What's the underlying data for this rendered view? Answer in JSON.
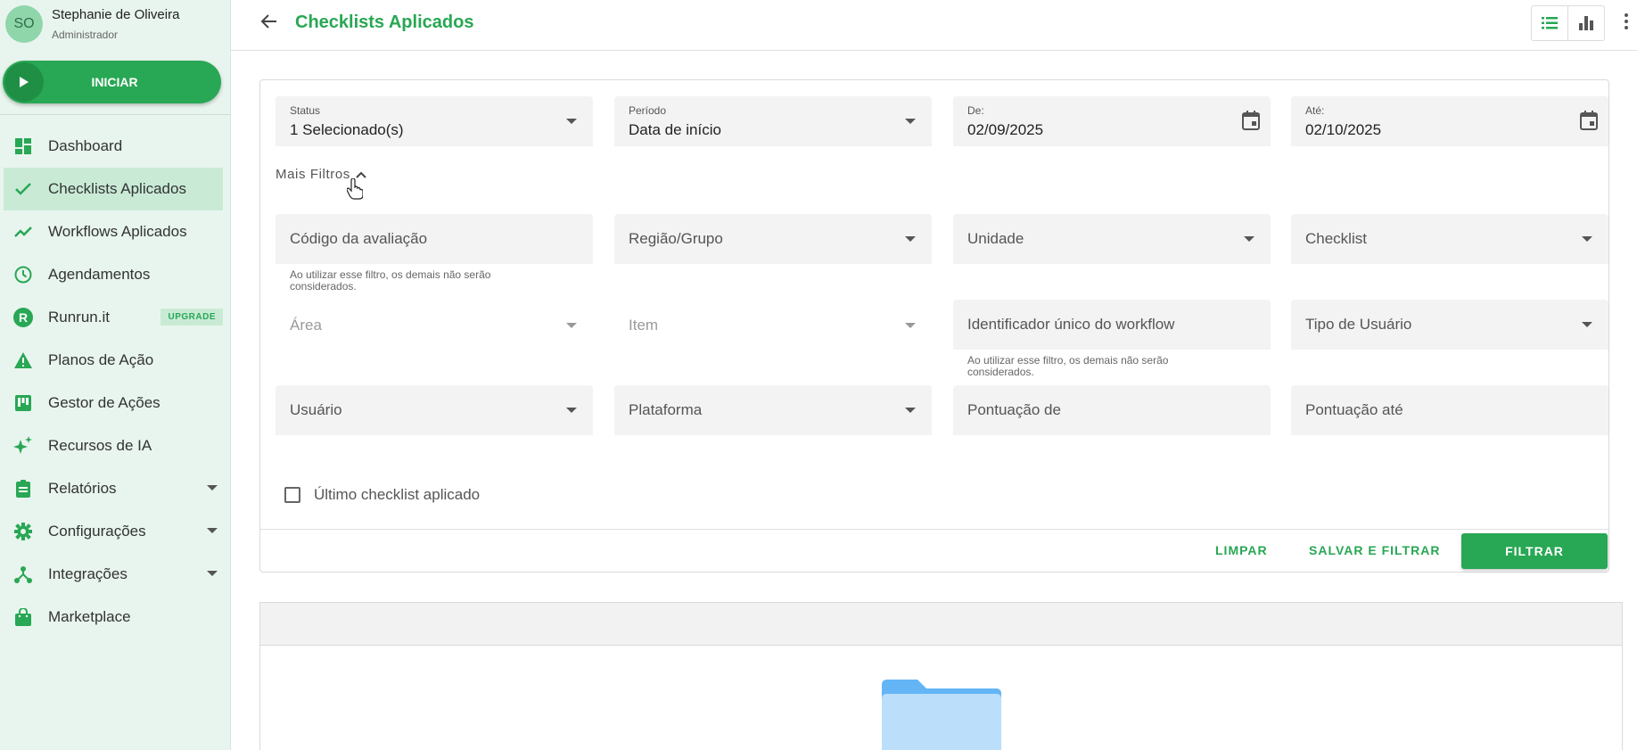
{
  "user": {
    "initials": "SO",
    "name": "Stephanie de Oliveira",
    "role": "Administrador"
  },
  "sidebar": {
    "start_label": "INICIAR",
    "items": [
      {
        "label": "Dashboard",
        "icon": "dashboard-icon"
      },
      {
        "label": "Checklists Aplicados",
        "icon": "check-icon",
        "active": true
      },
      {
        "label": "Workflows Aplicados",
        "icon": "trending-icon"
      },
      {
        "label": "Agendamentos",
        "icon": "clock-icon"
      },
      {
        "label": "Runrun.it",
        "icon": "runrun-logo-icon",
        "badge": "UPGRADE"
      },
      {
        "label": "Planos de Ação",
        "icon": "warning-icon"
      },
      {
        "label": "Gestor de Ações",
        "icon": "kanban-icon"
      },
      {
        "label": "Recursos de IA",
        "icon": "sparkle-icon"
      },
      {
        "label": "Relatórios",
        "icon": "clipboard-icon",
        "expandable": true
      },
      {
        "label": "Configurações",
        "icon": "gear-icon",
        "expandable": true
      },
      {
        "label": "Integrações",
        "icon": "integration-icon",
        "expandable": true
      },
      {
        "label": "Marketplace",
        "icon": "shopping-bag-icon"
      }
    ]
  },
  "header": {
    "title": "Checklists Aplicados"
  },
  "filters": {
    "status": {
      "label": "Status",
      "value": "1 Selecionado(s)"
    },
    "periodo": {
      "label": "Período",
      "value": "Data de início"
    },
    "de": {
      "label": "De:",
      "value": "02/09/2025"
    },
    "ate": {
      "label": "Até:",
      "value": "02/10/2025"
    },
    "more_filters": "Mais Filtros",
    "codigo": "Código da avaliação",
    "codigo_hint": "Ao utilizar esse filtro, os demais não serão considerados.",
    "regiao": "Região/Grupo",
    "unidade": "Unidade",
    "checklist": "Checklist",
    "area": "Área",
    "item": "Item",
    "workflow_id": "Identificador único do workflow",
    "workflow_hint": "Ao utilizar esse filtro, os demais não serão considerados.",
    "tipo_usuario": "Tipo de Usuário",
    "usuario": "Usuário",
    "plataforma": "Plataforma",
    "pontuacao_de": "Pontuação de",
    "pontuacao_ate": "Pontuação até",
    "ultimo_checklist": "Último checklist aplicado"
  },
  "actions": {
    "limpar": "LIMPAR",
    "salvar_filtrar": "SALVAR E FILTRAR",
    "filtrar": "FILTRAR"
  },
  "colors": {
    "primary": "#28a754",
    "sidebar_bg": "#e8f5ee",
    "active_bg": "#c9ebd6"
  }
}
